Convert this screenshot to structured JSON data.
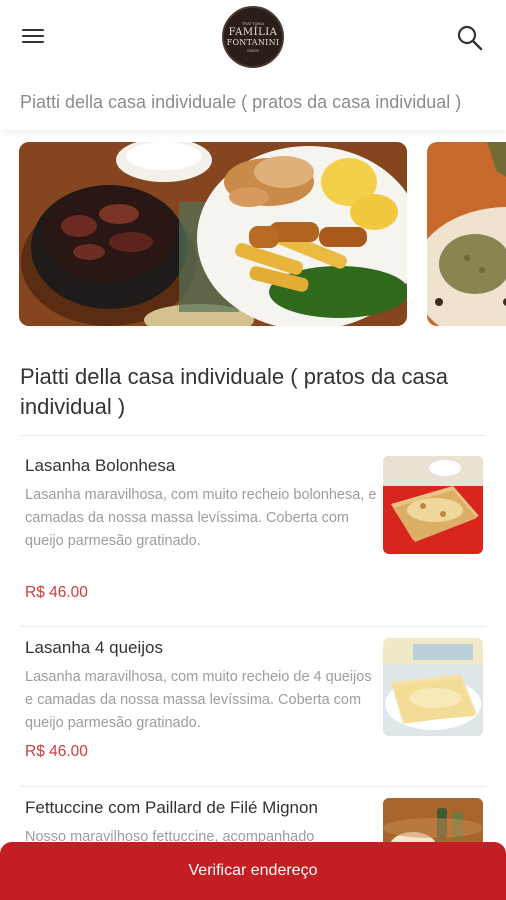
{
  "header": {
    "logo": {
      "line1": "FAMÍLIA",
      "line2": "FONTANINI",
      "tiny_top": "TRATTORIA",
      "tiny_bottom": "SINCE"
    },
    "menu_icon": "hamburger-menu-icon",
    "search_icon": "search-icon"
  },
  "category_bar": {
    "label": "Piatti della casa individuale ( pratos da casa individual )"
  },
  "section": {
    "title": "Piatti della casa individuale ( pratos da casa individual )"
  },
  "items": [
    {
      "name": "Lasanha Bolonhesa",
      "description": "Lasanha maravilhosa, com muito recheio bolonhesa, e camadas da nossa massa levíssima. Coberta com queijo parmesão gratinado.",
      "price": "R$ 46.00"
    },
    {
      "name": "Lasanha 4 queijos",
      "description": "Lasanha maravilhosa, com muito recheio de 4 queijos e camadas da nossa massa levíssima. Coberta com queijo parmesão gratinado.",
      "price": "R$ 46.00"
    },
    {
      "name": "Fettuccine com Paillard de Filé Mignon",
      "description": "Nosso maravilhoso fettuccine, acompanhado"
    }
  ],
  "cta": {
    "label": "Verificar endereço"
  },
  "colors": {
    "accent": "#c41d24",
    "price": "#d03a3a",
    "muted_text": "#9d9d9d"
  }
}
